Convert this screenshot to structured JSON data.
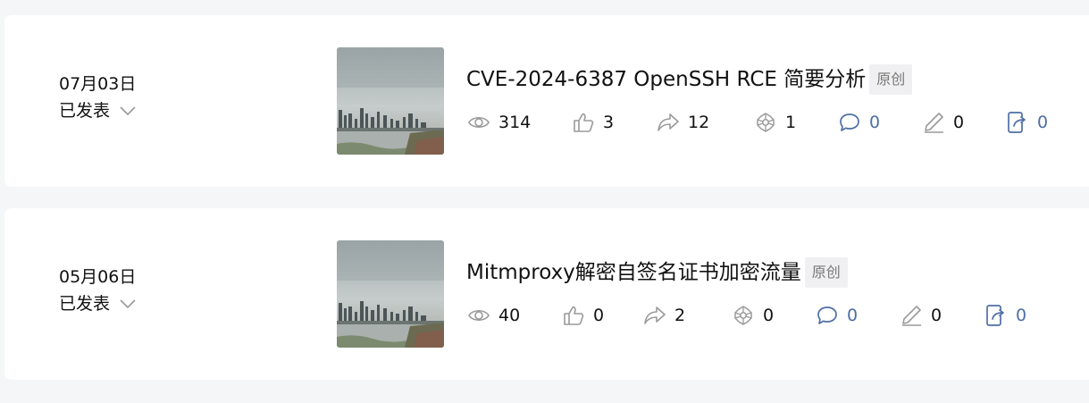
{
  "articles": [
    {
      "date": "07月03日",
      "status": "已发表",
      "title": "CVE-2024-6387 OpenSSH RCE 简要分析",
      "badge": "原创",
      "stats": {
        "views": "314",
        "likes": "3",
        "shares": "12",
        "favorites": "1",
        "comments": "0",
        "edits": "0",
        "forwards": "0"
      }
    },
    {
      "date": "05月06日",
      "status": "已发表",
      "title": "Mitmproxy解密自签名证书加密流量",
      "badge": "原创",
      "stats": {
        "views": "40",
        "likes": "0",
        "shares": "2",
        "favorites": "0",
        "comments": "0",
        "edits": "0",
        "forwards": "0"
      }
    }
  ],
  "icons": {
    "views": "eye-icon",
    "likes": "thumbs-up-icon",
    "shares": "share-arrow-icon",
    "favorites": "flower-icon",
    "comments": "comment-icon",
    "edits": "pencil-icon",
    "forwards": "forward-icon",
    "status": "chevron-down-icon"
  },
  "colors": {
    "icon_gray": "#9a9a9a",
    "icon_blue": "#4e6ea5",
    "badge_bg": "#f0f0f2",
    "page_bg": "#f5f6f7"
  }
}
